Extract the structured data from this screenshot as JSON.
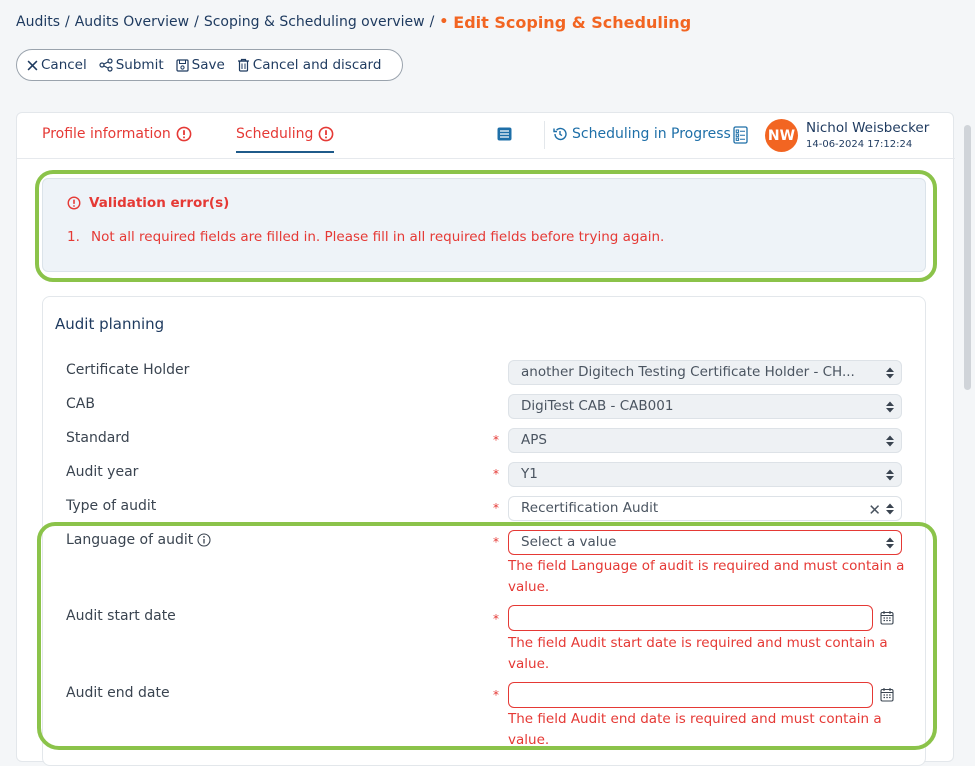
{
  "breadcrumb": {
    "items": [
      "Audits",
      "Audits Overview",
      "Scoping & Scheduling overview"
    ],
    "separator": "/",
    "current_marker": "•",
    "current": "Edit Scoping & Scheduling"
  },
  "toolbar": {
    "cancel": "Cancel",
    "submit": "Submit",
    "save": "Save",
    "cancel_discard": "Cancel and discard"
  },
  "tabs": [
    {
      "label": "Profile information",
      "has_error": true
    },
    {
      "label": "Scheduling",
      "has_error": true,
      "active": true
    }
  ],
  "status": {
    "label": "Scheduling in Progress"
  },
  "user": {
    "initials": "NW",
    "name": "Nichol Weisbecker",
    "timestamp": "14-06-2024 17:12:24"
  },
  "validation": {
    "title": "Validation error(s)",
    "items": [
      {
        "number": "1.",
        "text": "Not all required fields are filled in. Please fill in all required fields before trying again."
      }
    ]
  },
  "panel": {
    "title": "Audit planning"
  },
  "fields": {
    "certificate_holder": {
      "label": "Certificate Holder",
      "value": "another Digitech Testing Certificate Holder - CH..."
    },
    "cab": {
      "label": "CAB",
      "value": "DigiTest CAB - CAB001"
    },
    "standard": {
      "label": "Standard",
      "required": "*",
      "value": "APS"
    },
    "audit_year": {
      "label": "Audit year",
      "required": "*",
      "value": "Y1"
    },
    "type_of_audit": {
      "label": "Type of audit",
      "required": "*",
      "value": "Recertification Audit",
      "clear": "✕"
    },
    "language_of_audit": {
      "label": "Language of audit",
      "required": "*",
      "placeholder": "Select a value",
      "error_line1": "The field Language of audit is required and must contain a",
      "error_line2": "value."
    },
    "audit_start_date": {
      "label": "Audit start date",
      "required": "*",
      "value": "",
      "error_line1": "The field Audit start date is required and must contain a",
      "error_line2": "value."
    },
    "audit_end_date": {
      "label": "Audit end date",
      "required": "*",
      "value": "",
      "error_line1": "The field Audit end date is required and must contain a",
      "error_line2": "value."
    }
  },
  "colors": {
    "accent_orange": "#f26522",
    "error_red": "#e53935",
    "navy": "#1e3a5f",
    "highlight_green": "#8bc34a"
  }
}
